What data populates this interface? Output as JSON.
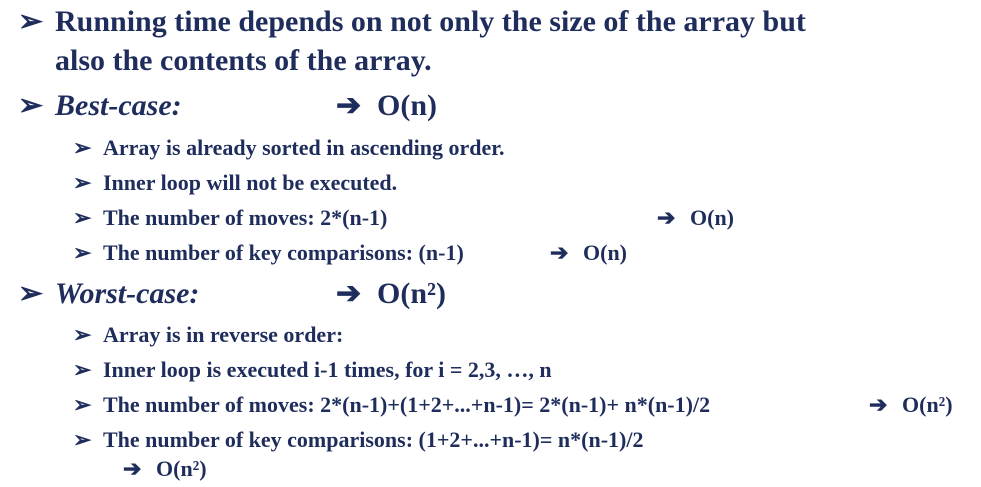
{
  "bullets": {
    "level1": "➢",
    "level2": "➢",
    "arrow": "➔"
  },
  "intro": {
    "line1": "Running time depends on not only the size of the array but",
    "line2": "also the contents of the array."
  },
  "best_case": {
    "label": "Best-case:",
    "complexity": "O(n)",
    "items": [
      {
        "text": "Array is already sorted in ascending order."
      },
      {
        "text": "Inner loop will not be executed."
      },
      {
        "text": "The number of moves: 2*(n-1)",
        "result": "O(n)"
      },
      {
        "text": "The number of key comparisons: (n-1)",
        "result": "O(n)"
      }
    ]
  },
  "worst_case": {
    "label": "Worst-case:",
    "complexity": "O(n²)",
    "items": [
      {
        "text": "Array is in reverse order:"
      },
      {
        "text": "Inner loop is executed i-1 times, for i = 2,3, …, n"
      },
      {
        "text": "The number of moves: 2*(n-1)+(1+2+...+n-1)= 2*(n-1)+ n*(n-1)/2",
        "result": "O(n²)"
      },
      {
        "text": "The number of key comparisons: (1+2+...+n-1)= n*(n-1)/2",
        "result": "O(n²)"
      }
    ]
  }
}
